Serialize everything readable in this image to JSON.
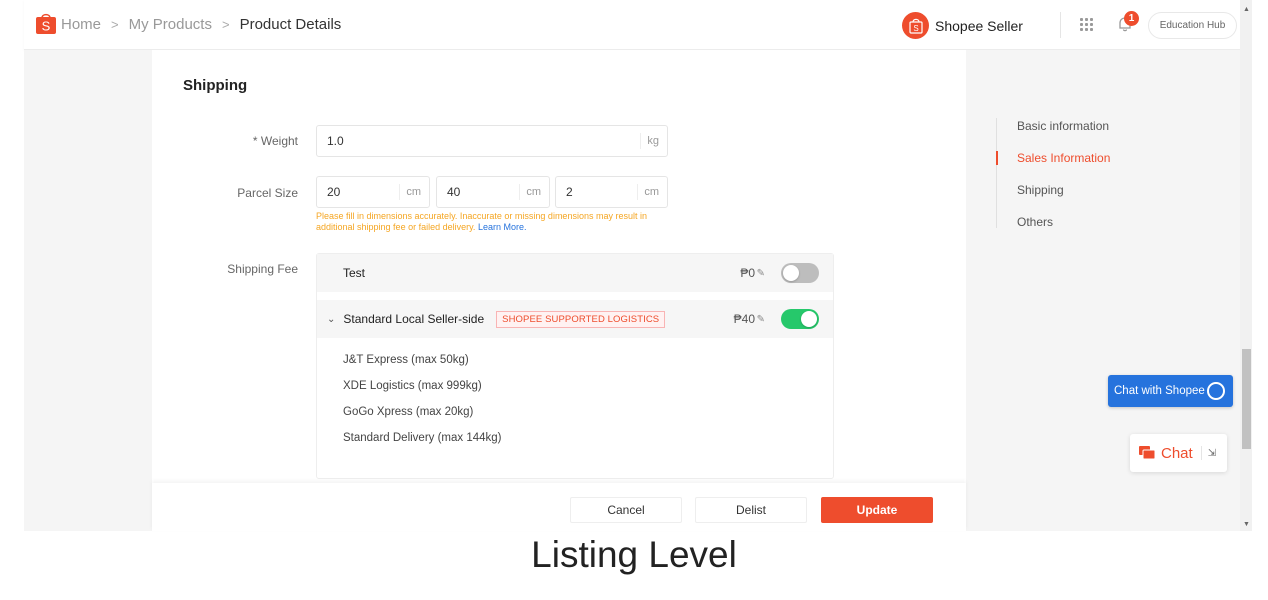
{
  "header": {
    "breadcrumb": [
      {
        "label": "Home"
      },
      {
        "label": "My Products"
      },
      {
        "label": "Product Details"
      }
    ],
    "separator": ">",
    "seller_name": "Shopee Seller",
    "notification_count": "1",
    "education_hub": "Education Hub"
  },
  "shipping": {
    "title": "Shipping",
    "weight": {
      "label": "* Weight",
      "value": "1.0",
      "unit": "kg"
    },
    "parcel_size": {
      "label": "Parcel Size",
      "dims": [
        {
          "value": "20",
          "unit": "cm"
        },
        {
          "value": "40",
          "unit": "cm"
        },
        {
          "value": "2",
          "unit": "cm"
        }
      ],
      "hint": "Please fill in dimensions accurately. Inaccurate or missing dimensions may result in additional shipping fee or failed delivery.",
      "learn_more": "Learn More."
    },
    "shipping_fee": {
      "label": "Shipping Fee",
      "channels": [
        {
          "name": "Test",
          "price": "₱0",
          "enabled": false
        },
        {
          "name": "Standard Local Seller-side",
          "tag": "SHOPEE SUPPORTED LOGISTICS",
          "price": "₱40",
          "enabled": true,
          "expanded": true
        }
      ],
      "logistics": [
        "J&T Express  (max 50kg)",
        "XDE Logistics  (max 999kg)",
        "GoGo Xpress  (max 20kg)",
        "Standard Delivery  (max 144kg)"
      ]
    }
  },
  "footer": {
    "cancel": "Cancel",
    "delist": "Delist",
    "update": "Update"
  },
  "side_nav": {
    "items": [
      {
        "label": "Basic information",
        "active": false
      },
      {
        "label": "Sales Information",
        "active": true
      },
      {
        "label": "Shipping",
        "active": false
      },
      {
        "label": "Others",
        "active": false
      }
    ]
  },
  "chat": {
    "chat_with_shopee": "Chat with Shopee",
    "chat_label": "Chat"
  },
  "caption": "Listing Level",
  "colors": {
    "brand": "#ee4d2d",
    "toggle_on": "#26c86b",
    "toggle_off": "#bdbdbd",
    "hint": "#f5a623",
    "link": "#2673dd"
  }
}
